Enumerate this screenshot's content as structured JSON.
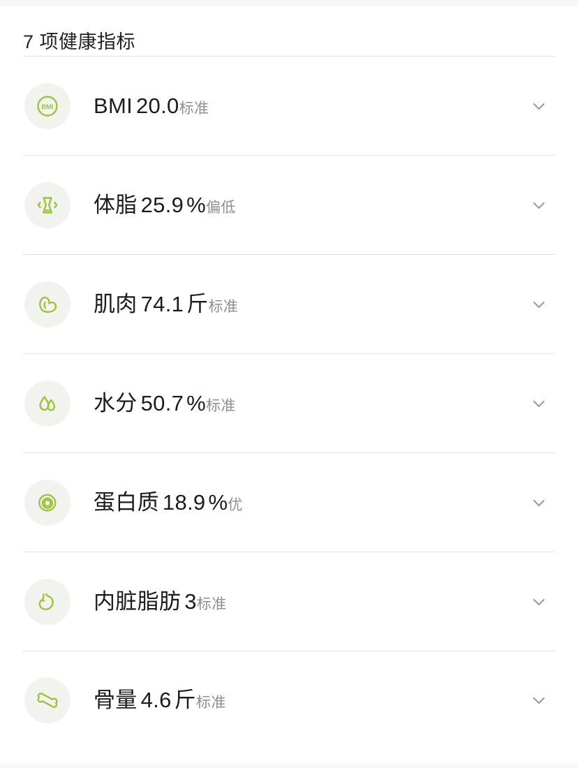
{
  "header": {
    "title": "7 项健康指标"
  },
  "theme": {
    "icon_green": "#9bc53d",
    "icon_bg": "#f2f2ef",
    "divider": "#e2e2e2",
    "primary_text": "#1c1c1c",
    "secondary_text": "#8e8e8e",
    "chevron": "#9a9a9a",
    "background": "#ffffff"
  },
  "metrics": [
    {
      "icon": "bmi-circle-icon",
      "name": "BMI",
      "value": "20.0",
      "unit": "",
      "status": "标准",
      "chevron": "chevron-down-icon"
    },
    {
      "icon": "body-fat-icon",
      "name": "体脂",
      "value": "25.9",
      "unit": "%",
      "status": "偏低",
      "chevron": "chevron-down-icon"
    },
    {
      "icon": "muscle-icon",
      "name": "肌肉",
      "value": "74.1",
      "unit": "斤",
      "status": "标准",
      "chevron": "chevron-down-icon"
    },
    {
      "icon": "water-drop-icon",
      "name": "水分",
      "value": "50.7",
      "unit": "%",
      "status": "标准",
      "chevron": "chevron-down-icon"
    },
    {
      "icon": "protein-icon",
      "name": "蛋白质",
      "value": "18.9",
      "unit": "%",
      "status": "优",
      "chevron": "chevron-down-icon"
    },
    {
      "icon": "visceral-fat-icon",
      "name": "内脏脂肪",
      "value": "3",
      "unit": "",
      "status": "标准",
      "chevron": "chevron-down-icon"
    },
    {
      "icon": "bone-icon",
      "name": "骨量",
      "value": "4.6",
      "unit": "斤",
      "status": "标准",
      "chevron": "chevron-down-icon"
    }
  ]
}
